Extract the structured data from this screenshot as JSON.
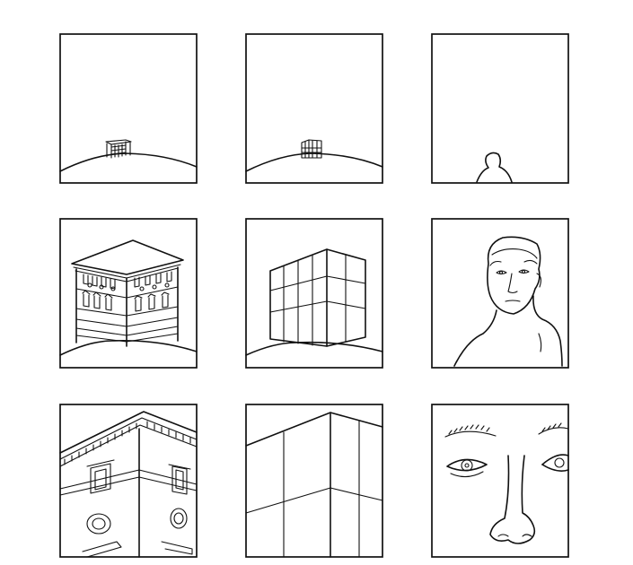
{
  "panels": [
    {
      "row": 1,
      "col": 1,
      "subject": "palazzo",
      "scale": "distant"
    },
    {
      "row": 1,
      "col": 2,
      "subject": "grid-building",
      "scale": "distant"
    },
    {
      "row": 1,
      "col": 3,
      "subject": "person",
      "scale": "distant"
    },
    {
      "row": 2,
      "col": 1,
      "subject": "palazzo",
      "scale": "medium"
    },
    {
      "row": 2,
      "col": 2,
      "subject": "grid-building",
      "scale": "medium"
    },
    {
      "row": 2,
      "col": 3,
      "subject": "person",
      "scale": "medium"
    },
    {
      "row": 3,
      "col": 1,
      "subject": "palazzo",
      "scale": "close-up"
    },
    {
      "row": 3,
      "col": 2,
      "subject": "grid-building",
      "scale": "close-up"
    },
    {
      "row": 3,
      "col": 3,
      "subject": "person",
      "scale": "close-up"
    }
  ]
}
